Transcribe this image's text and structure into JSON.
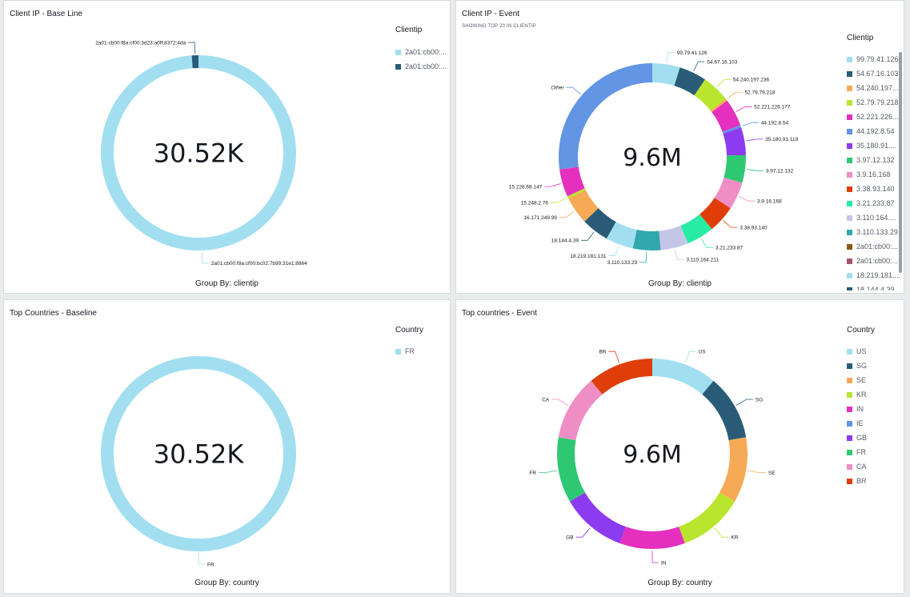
{
  "panels": [
    {
      "title": "Client IP - Base Line",
      "subtitle": "",
      "group_by": "Group By: clientip",
      "legend_title": "Clientip",
      "legend_items": [
        {
          "label": "2a01:cb00:...",
          "color": "#a1dff0"
        },
        {
          "label": "2a01:cb00:...",
          "color": "#2a5c78"
        }
      ]
    },
    {
      "title": "Client IP - Event",
      "subtitle": "SHOWING TOP 20 IN CLIENTIP",
      "group_by": "Group By: clientip",
      "legend_title": "Clientip",
      "legend_items": [
        {
          "label": "99.79.41.126",
          "color": "#a1dff0"
        },
        {
          "label": "54.67.16.103",
          "color": "#2a5c78"
        },
        {
          "label": "54.240.197....",
          "color": "#f7aa55"
        },
        {
          "label": "52.79.79.218",
          "color": "#b9e52f"
        },
        {
          "label": "52.221.226....",
          "color": "#e52fbe"
        },
        {
          "label": "44.192.8.54",
          "color": "#6295e3"
        },
        {
          "label": "35.180.91....",
          "color": "#8c3bf0"
        },
        {
          "label": "3.97.12.132",
          "color": "#2ec872"
        },
        {
          "label": "3.9.16.168",
          "color": "#ef8ec5"
        },
        {
          "label": "3.38.93.140",
          "color": "#e03e09"
        },
        {
          "label": "3.21.233.87",
          "color": "#29eca4"
        },
        {
          "label": "3.110.164....",
          "color": "#c4c6e8"
        },
        {
          "label": "3.110.133.29",
          "color": "#31a8ad"
        },
        {
          "label": "2a01:cb00:...",
          "color": "#8d5b14"
        },
        {
          "label": "2a01:cb00:...",
          "color": "#a6556f"
        },
        {
          "label": "18.219.181....",
          "color": "#a1dff0"
        },
        {
          "label": "18.144.4.39",
          "color": "#2a5c78"
        }
      ]
    },
    {
      "title": "Top Countries - Baseline",
      "subtitle": "",
      "group_by": "Group By: country",
      "legend_title": "Country",
      "legend_items": [
        {
          "label": "FR",
          "color": "#a1dff0"
        }
      ]
    },
    {
      "title": "Top countries - Event",
      "subtitle": "",
      "group_by": "Group By: country",
      "legend_title": "Country",
      "legend_items": [
        {
          "label": "US",
          "color": "#a1dff0"
        },
        {
          "label": "SG",
          "color": "#2a5c78"
        },
        {
          "label": "SE",
          "color": "#f7aa55"
        },
        {
          "label": "KR",
          "color": "#b9e52f"
        },
        {
          "label": "IN",
          "color": "#e52fbe"
        },
        {
          "label": "IE",
          "color": "#6295e3"
        },
        {
          "label": "GB",
          "color": "#8c3bf0"
        },
        {
          "label": "FR",
          "color": "#2ec872"
        },
        {
          "label": "CA",
          "color": "#ef8ec5"
        },
        {
          "label": "BR",
          "color": "#e03e09"
        }
      ]
    }
  ],
  "chart_data": [
    {
      "type": "pie",
      "style": "donut",
      "title": "Client IP - Base Line",
      "center_value": "30.52K",
      "slices": [
        {
          "label": "2a01:cb00:f8a:cf00:bc02:7b99:31e1:8864",
          "value": 98.9,
          "color": "#a1dff0"
        },
        {
          "label": "2a01:cb00:f8a:cf00:3d23:a0ff:8372:4da",
          "value": 1.1,
          "color": "#2a5c78"
        }
      ]
    },
    {
      "type": "pie",
      "style": "donut",
      "title": "Client IP - Event",
      "center_value": "9.6M",
      "slices": [
        {
          "label": "99.79.41.126",
          "value": 4.5,
          "color": "#a1dff0"
        },
        {
          "label": "54.67.16.103",
          "value": 4.5,
          "color": "#2a5c78"
        },
        {
          "label": "54.240.197.236",
          "value": 4.5,
          "color": "#b9e52f"
        },
        {
          "label": "52.79.79.218",
          "value": 0.4,
          "color": "#f7aa55"
        },
        {
          "label": "52.221.226.177",
          "value": 4.5,
          "color": "#e52fbe"
        },
        {
          "label": "44.192.8.54",
          "value": 0.4,
          "color": "#6295e3"
        },
        {
          "label": "35.180.91.119",
          "value": 4.5,
          "color": "#8c3bf0"
        },
        {
          "label": "3.97.12.132",
          "value": 4.5,
          "color": "#2ec872"
        },
        {
          "label": "3.9.16.168",
          "value": 4.5,
          "color": "#ef8ec5"
        },
        {
          "label": "3.38.93.140",
          "value": 4.5,
          "color": "#e03e09"
        },
        {
          "label": "3.21.233.87",
          "value": 4.5,
          "color": "#29eca4"
        },
        {
          "label": "3.110.164.211",
          "value": 4.5,
          "color": "#c4c6e8"
        },
        {
          "label": "3.110.133.29",
          "value": 4.5,
          "color": "#31a8ad"
        },
        {
          "label": "18.219.181.131",
          "value": 4.5,
          "color": "#a1dff0"
        },
        {
          "label": "18.144.4.39",
          "value": 4.5,
          "color": "#2a5c78"
        },
        {
          "label": "16.171.249.99",
          "value": 4.5,
          "color": "#f7aa55"
        },
        {
          "label": "15.248.2.76",
          "value": 0.4,
          "color": "#b9e52f"
        },
        {
          "label": "15.228.68.147",
          "value": 4.5,
          "color": "#e52fbe"
        },
        {
          "label": "Other",
          "value": 25.6,
          "color": "#6295e3"
        }
      ]
    },
    {
      "type": "pie",
      "style": "donut",
      "title": "Top Countries - Baseline",
      "center_value": "30.52K",
      "slices": [
        {
          "label": "FR",
          "value": 100,
          "color": "#a1dff0"
        }
      ]
    },
    {
      "type": "pie",
      "style": "donut",
      "title": "Top countries - Event",
      "center_value": "9.6M",
      "slices": [
        {
          "label": "US",
          "value": 10,
          "color": "#a1dff0"
        },
        {
          "label": "SG",
          "value": 10,
          "color": "#2a5c78"
        },
        {
          "label": "SE",
          "value": 10,
          "color": "#f7aa55"
        },
        {
          "label": "KR",
          "value": 10,
          "color": "#b9e52f"
        },
        {
          "label": "IN",
          "value": 10,
          "color": "#e52fbe"
        },
        {
          "label": "GB",
          "value": 10,
          "color": "#8c3bf0"
        },
        {
          "label": "FR",
          "value": 10,
          "color": "#2ec872"
        },
        {
          "label": "CA",
          "value": 10,
          "color": "#ef8ec5"
        },
        {
          "label": "BR",
          "value": 10,
          "color": "#e03e09"
        }
      ]
    }
  ]
}
